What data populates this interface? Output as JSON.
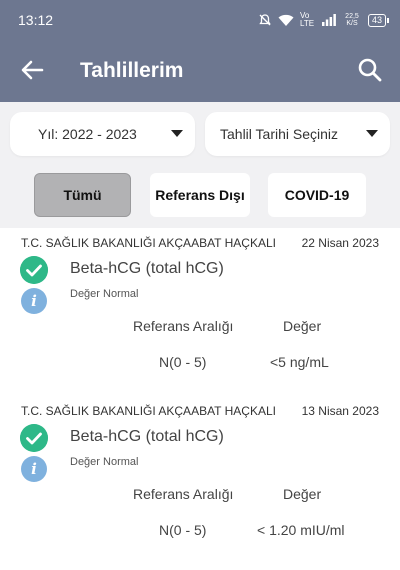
{
  "status_bar": {
    "time": "13:12",
    "network": "Vo LTE",
    "speed": "22,5 K/S",
    "battery": "43"
  },
  "app_bar": {
    "title": "Tahlillerim",
    "back_icon": "arrow-left-icon",
    "search_icon": "search-icon"
  },
  "filters": {
    "year": "Yıl: 2022 - 2023",
    "date": "Tahlil Tarihi Seçiniz"
  },
  "chips": [
    {
      "label": "Tümü",
      "active": true
    },
    {
      "label": "Referans Dışı",
      "active": false
    },
    {
      "label": "COVID-19",
      "active": false
    }
  ],
  "records": [
    {
      "hospital": "T.C. SAĞLIK BAKANLIĞI AKÇAABAT HAÇKALI",
      "date": "22 Nisan 2023",
      "test": "Beta-hCG (total hCG)",
      "status": "Değer Normal",
      "ref_header": "Referans Aralığı",
      "value_header": "Değer",
      "ref": "N(0 - 5)",
      "value": "<5 ng/mL"
    },
    {
      "hospital": "T.C. SAĞLIK BAKANLIĞI AKÇAABAT HAÇKALI",
      "date": "13 Nisan 2023",
      "test": "Beta-hCG (total hCG)",
      "status": "Değer Normal",
      "ref_header": "Referans Aralığı",
      "value_header": "Değer",
      "ref": "N(0 - 5)",
      "value": "< 1.20 mIU/ml"
    }
  ],
  "colors": {
    "header": "#6d7790",
    "check": "#2eb888",
    "info": "#7fb1de",
    "active_chip": "#b2b2b4"
  }
}
